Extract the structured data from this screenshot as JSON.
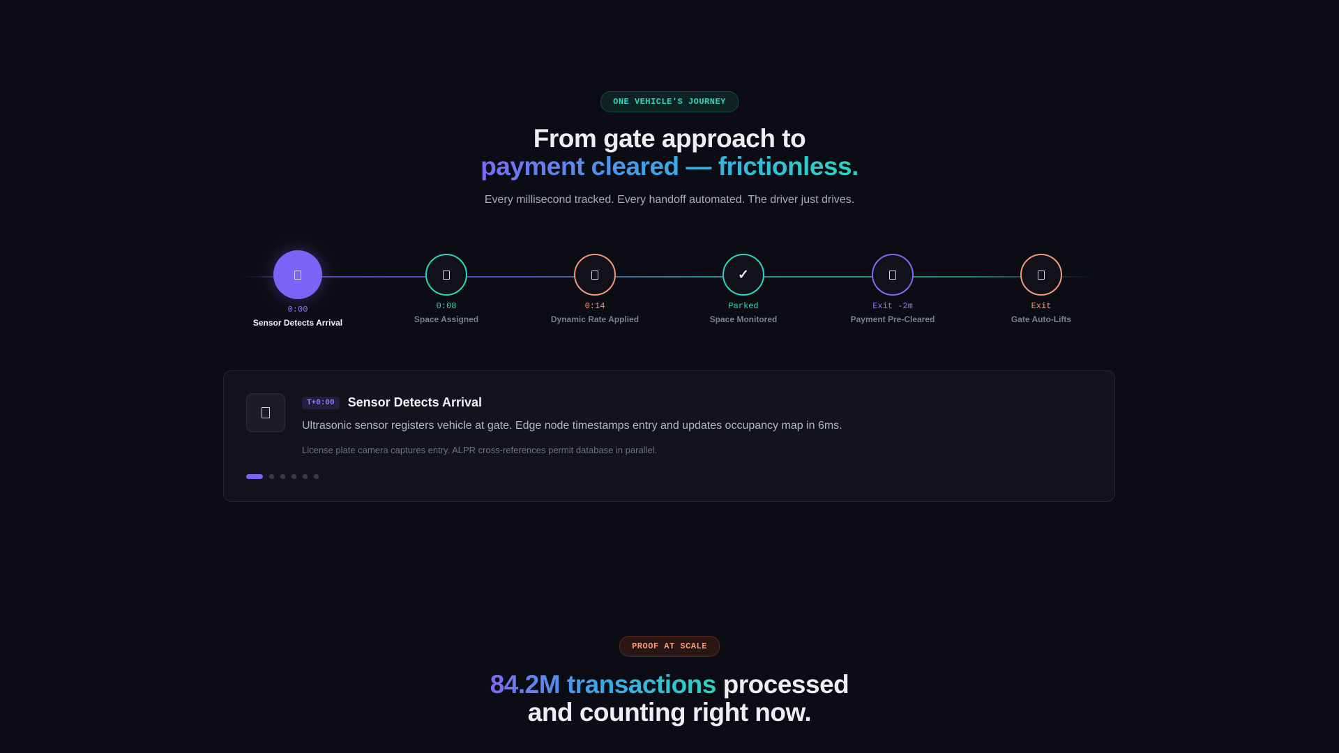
{
  "journey": {
    "badge": "ONE VEHICLE'S JOURNEY",
    "headline_line1": "From gate approach to",
    "headline_line2": "payment cleared — frictionless.",
    "subtitle": "Every millisecond tracked. Every handoff automated. The driver just drives.",
    "active_step": 0,
    "steps": [
      {
        "time": "0:00",
        "label": "Sensor Detects Arrival",
        "icon": "sensor-icon",
        "color": "#7c63f6"
      },
      {
        "time": "0:08",
        "label": "Space Assigned",
        "icon": "parking-space-icon",
        "color": "#2dd4bf"
      },
      {
        "time": "0:14",
        "label": "Dynamic Rate Applied",
        "icon": "rate-icon",
        "color": "#f8977a"
      },
      {
        "time": "Parked",
        "label": "Space Monitored",
        "icon": "check-icon",
        "color": "#2dd4bf"
      },
      {
        "time": "Exit -2m",
        "label": "Payment Pre-Cleared",
        "icon": "payment-icon",
        "color": "#7f6af4"
      },
      {
        "time": "Exit",
        "label": "Gate Auto-Lifts",
        "icon": "gate-icon",
        "color": "#f8977a"
      }
    ]
  },
  "detail": {
    "tag": "T+0:00",
    "title": "Sensor Detects Arrival",
    "description": "Ultrasonic sensor registers vehicle at gate. Edge node timestamps entry and updates occupancy map in 6ms.",
    "note": "License plate camera captures entry. ALPR cross-references permit database in parallel.",
    "icon": "sensor-icon",
    "page_count": 6,
    "current_page": 1
  },
  "proof": {
    "badge": "PROOF AT SCALE",
    "headline_highlight": "84.2M transactions",
    "headline_rest": " processed",
    "headline_line2": "and counting right now."
  }
}
